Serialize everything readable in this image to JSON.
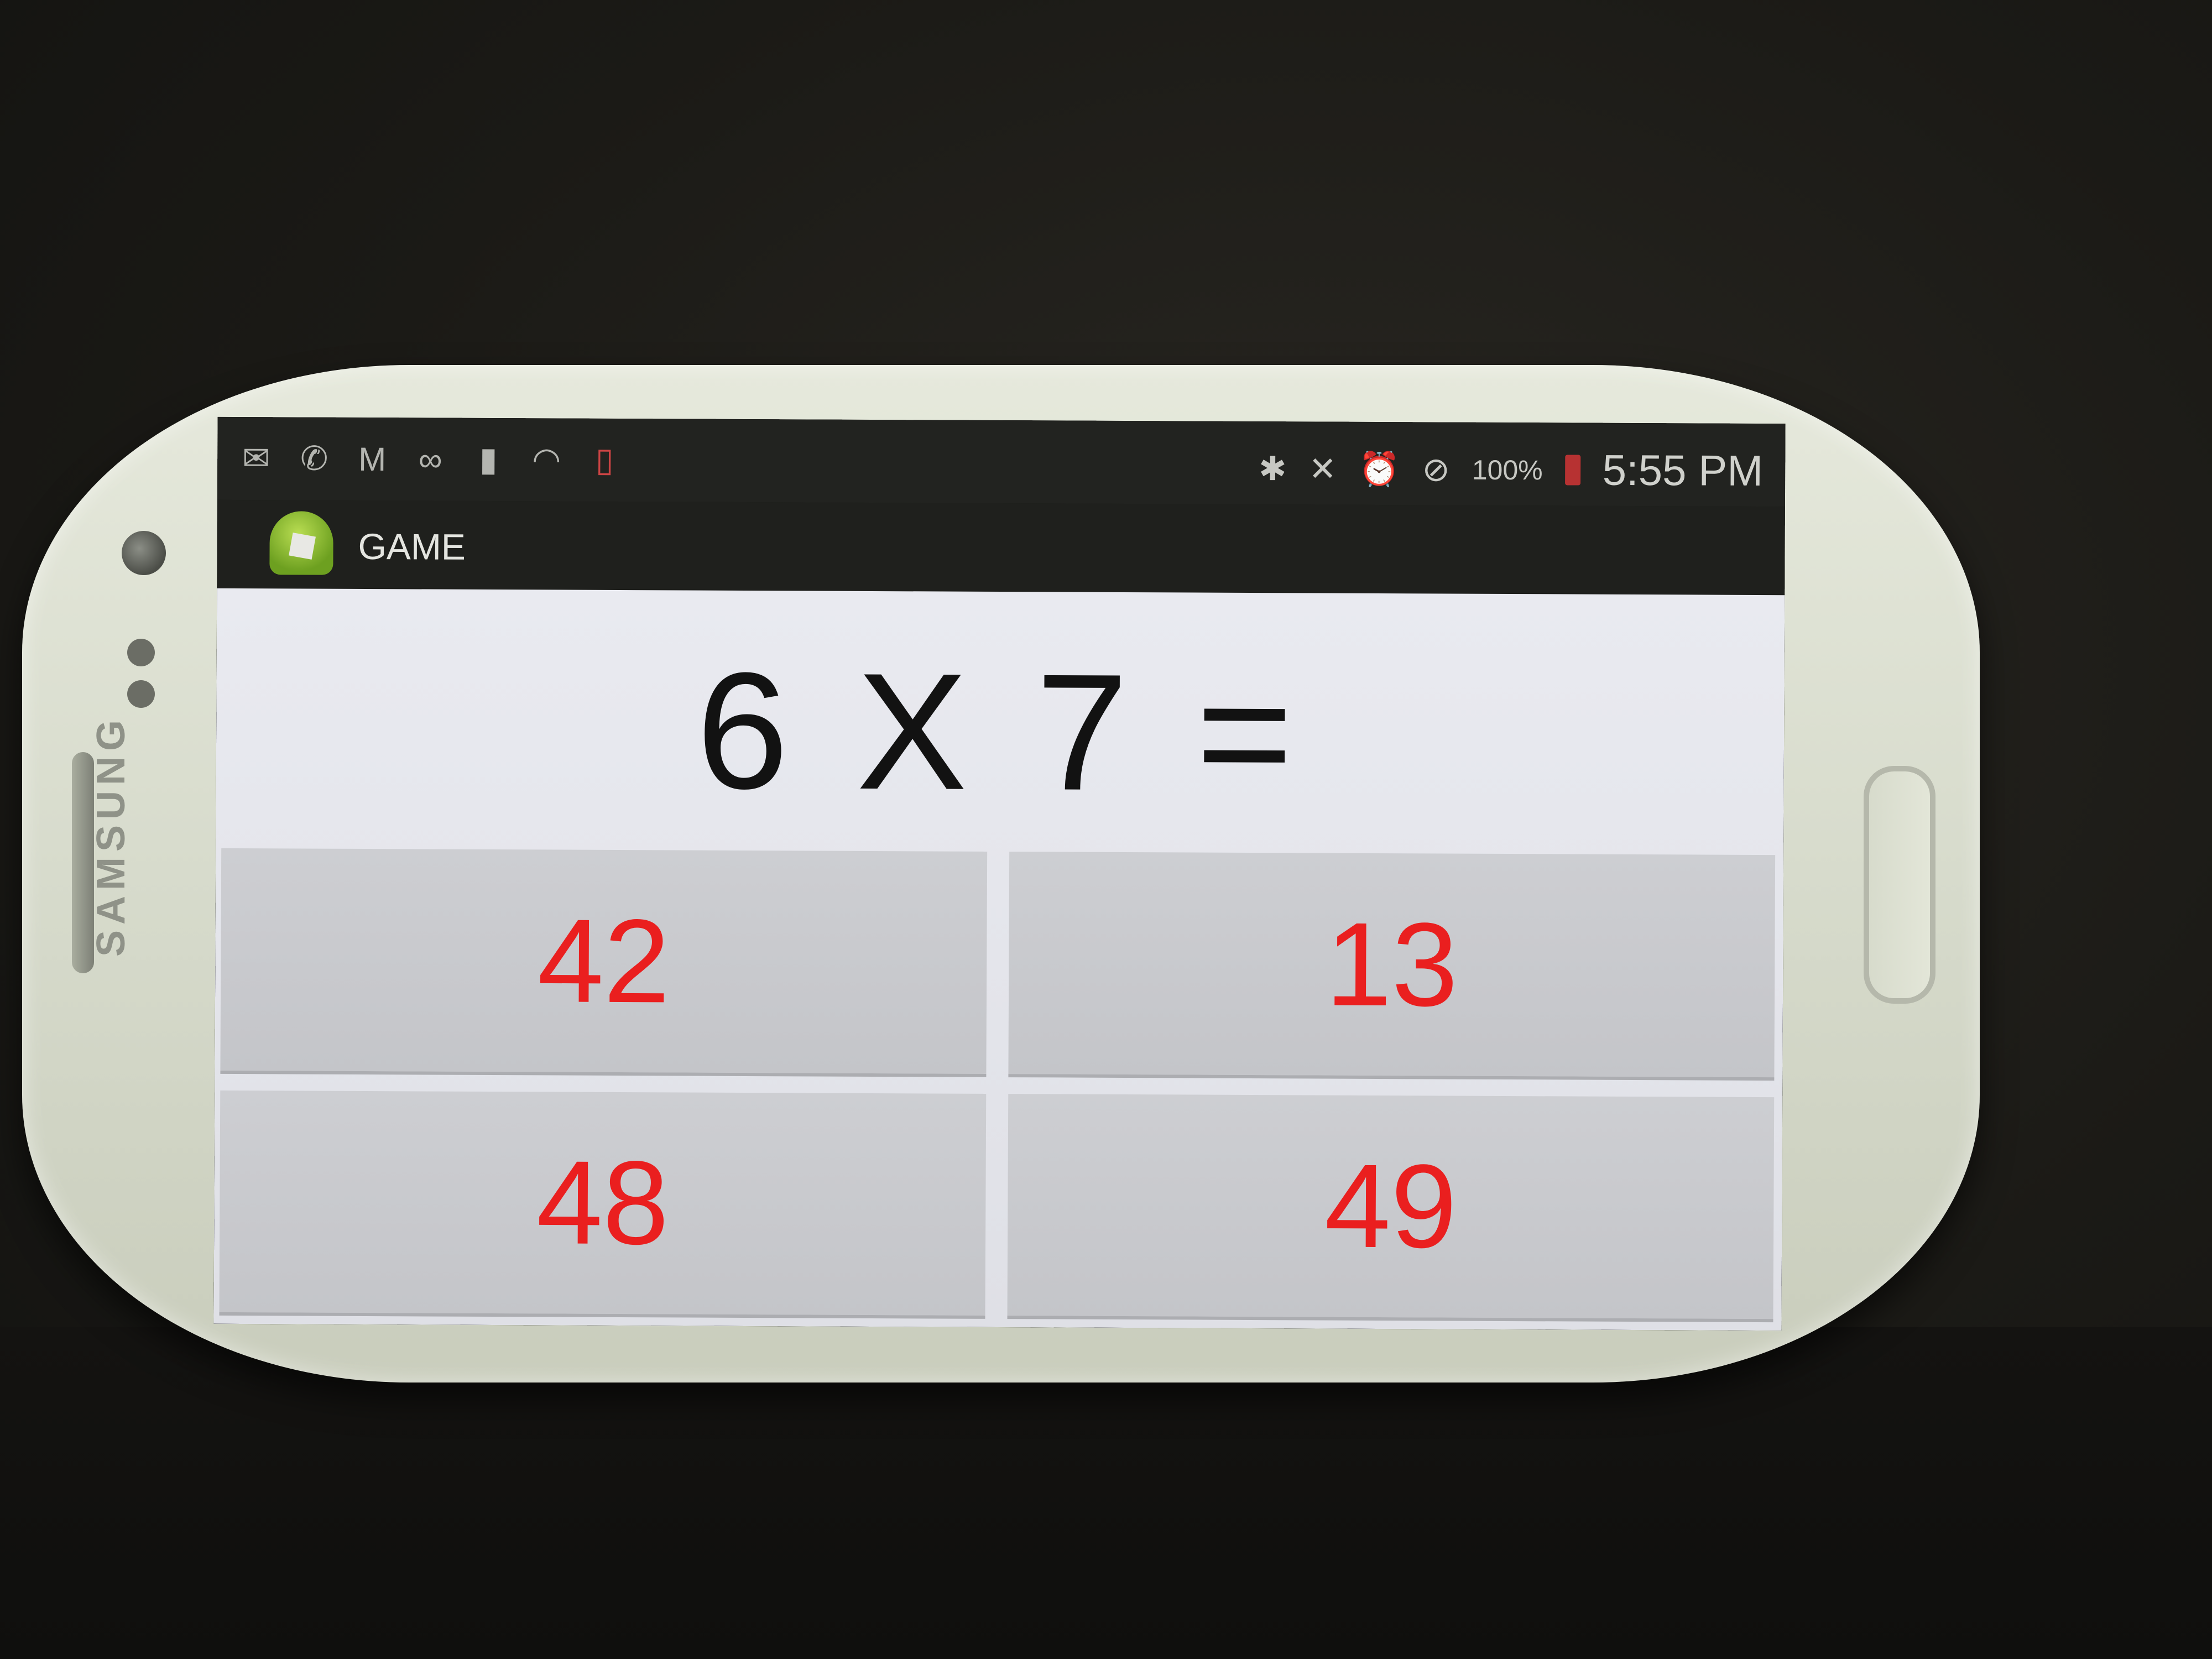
{
  "status_bar": {
    "left_icons": [
      "mail-icon",
      "missed-call-icon",
      "gmail-icon",
      "voicemail-icon",
      "sim-icon",
      "wifi-icon",
      "no-sd-card-icon"
    ],
    "right_icons": [
      "bluetooth-icon",
      "mute-icon",
      "alarm-icon",
      "do-not-disturb-icon"
    ],
    "battery": "100%",
    "time": "5:55 PM"
  },
  "action_bar": {
    "app_icon": "android-app-icon",
    "title": "GAME"
  },
  "question": "6 X 7 =",
  "answers": [
    "42",
    "13",
    "48",
    "49"
  ],
  "device": {
    "brand": "SAMSUNG"
  },
  "colors": {
    "answer_text": "#ea1f1f",
    "question_text": "#121212",
    "content_bg": "#e9eaf0",
    "button_bg": "#cdced2",
    "statusbar_bg": "#222320"
  }
}
